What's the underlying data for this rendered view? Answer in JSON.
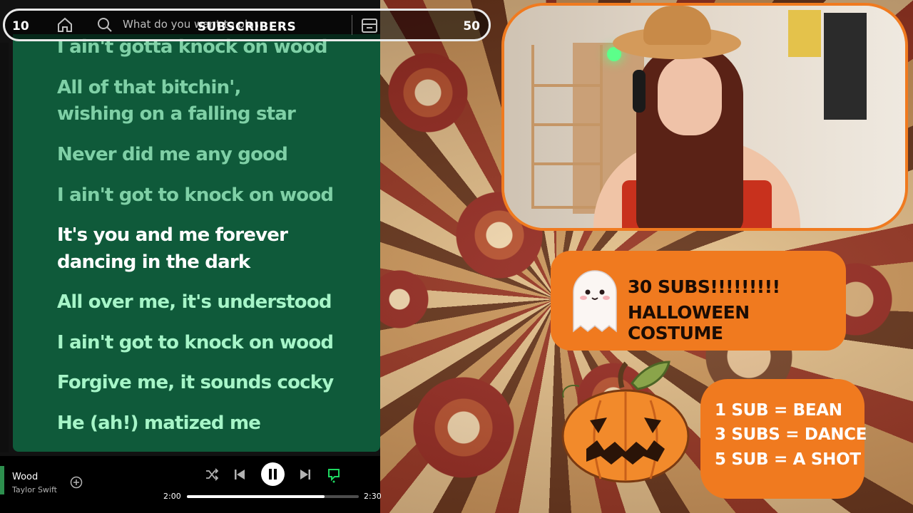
{
  "top_bar": {
    "left_count": "10",
    "right_count": "50",
    "title": "SUBSCRIBERS",
    "search_placeholder": "What do you want to play?"
  },
  "lyrics": [
    {
      "text": "I ain't gotta knock on wood",
      "state": "dim"
    },
    {
      "text": "All of that bitchin',",
      "state": "dim"
    },
    {
      "text": "wishing on a falling star",
      "state": "dim"
    },
    {
      "text": "Never did me any good",
      "state": "dim"
    },
    {
      "text": "I ain't got to knock on wood",
      "state": "dim"
    },
    {
      "text": "It's you and me forever",
      "state": "active"
    },
    {
      "text": "dancing in the dark",
      "state": "active"
    },
    {
      "text": "All over me, it's understood",
      "state": "upcoming"
    },
    {
      "text": "I ain't got to knock on wood",
      "state": "upcoming"
    },
    {
      "text": "Forgive me, it sounds cocky",
      "state": "upcoming"
    },
    {
      "text": "He (ah!) matized me",
      "state": "upcoming"
    }
  ],
  "player": {
    "song": "Wood",
    "artist": "Taylor Swift",
    "time_elapsed": "2:00",
    "time_total": "2:30",
    "progress": 0.8
  },
  "goal": {
    "line1": "30 SUBS!!!!!!!!!",
    "line2": "HALLOWEEN COSTUME"
  },
  "menu": {
    "items": [
      "1 SUB = BEAN",
      "3 SUBS =  DANCE",
      "5 SUB = A SHOT"
    ]
  },
  "colors": {
    "spotify_green": "#0f5a3a",
    "overlay_orange": "#f07a1f"
  }
}
